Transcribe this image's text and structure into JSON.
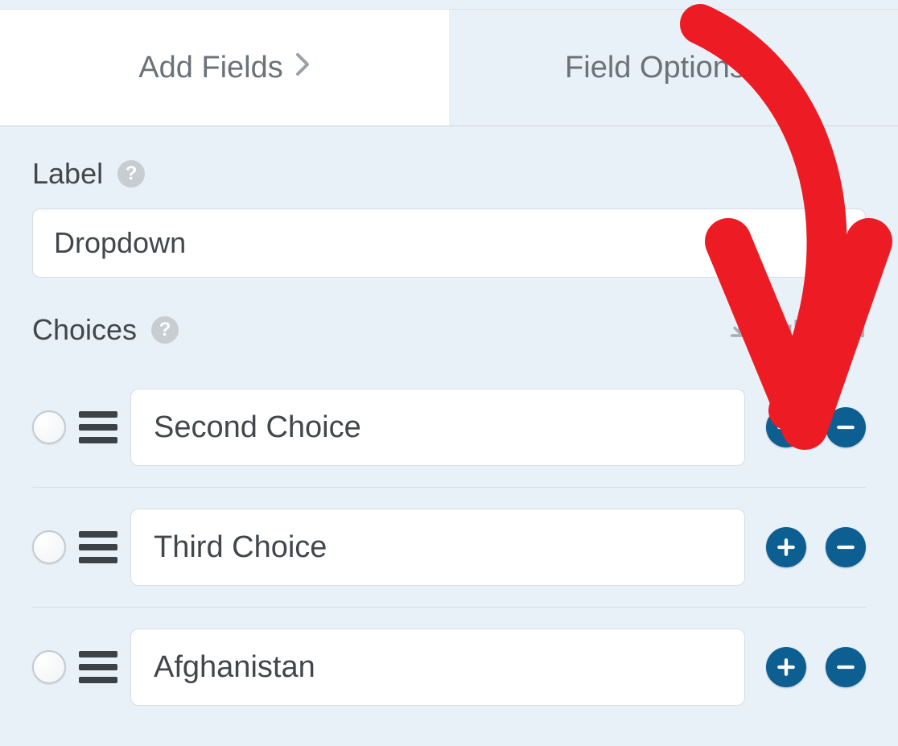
{
  "tabs": {
    "add_fields": "Add Fields",
    "field_options": "Field Options"
  },
  "label_section": {
    "title": "Label",
    "value": "Dropdown"
  },
  "choices_section": {
    "title": "Choices",
    "bulk_add": "Bulk Add"
  },
  "choices": [
    {
      "value": "Second Choice"
    },
    {
      "value": "Third Choice"
    },
    {
      "value": "Afghanistan"
    }
  ],
  "colors": {
    "accent": "#0e5f91",
    "panel_bg": "#e8f0f8",
    "arrow": "#ed1c24"
  }
}
